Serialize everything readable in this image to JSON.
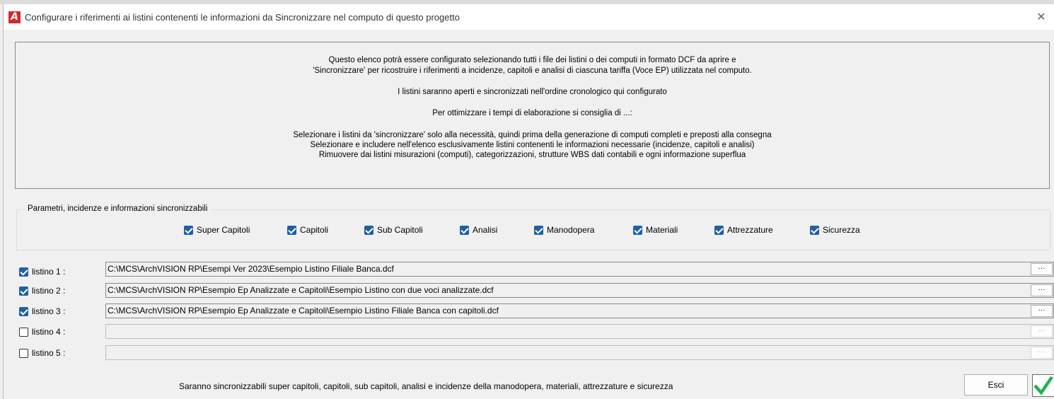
{
  "window": {
    "title": "Configurare i riferimenti ai listini contenenti le informazioni da Sincronizzare nel computo di questo progetto",
    "close_glyph": "✕"
  },
  "info": {
    "lines": [
      "Questo elenco potrà essere configurato selezionando tutti i file dei listini o dei computi in formato DCF da aprire e",
      "'Sincronizzare' per ricostruire i riferimenti a incidenze, capitoli e analisi di ciascuna tariffa (Voce EP) utilizzata nel computo.",
      "I listini saranno aperti e sincronizzati nell'ordine cronologico qui configurato",
      "Per ottimizzare i tempi di elaborazione si consiglia di ...:",
      "Selezionare i listini da 'sincronizzare' solo alla necessità, quindi prima della generazione di computi completi e preposti alla consegna",
      "Selezionare e includere nell'elenco esclusivamente listini contenenti le informazioni necessarie (incidenze, capitoli e analisi)",
      "Rimuovere dai listini misurazioni (computi), categorizzazioni, strutture WBS dati contabili e ogni informazione superflua"
    ]
  },
  "params": {
    "legend": "Parametri, incidenze e informazioni sincronizzabili",
    "options": [
      {
        "label": "Super Capitoli",
        "checked": true
      },
      {
        "label": "Capitoli",
        "checked": true
      },
      {
        "label": "Sub Capitoli",
        "checked": true
      },
      {
        "label": "Analisi",
        "checked": true
      },
      {
        "label": "Manodopera",
        "checked": true
      },
      {
        "label": "Materiali",
        "checked": true
      },
      {
        "label": "Attrezzature",
        "checked": true
      },
      {
        "label": "Sicurezza",
        "checked": true
      }
    ]
  },
  "listini": [
    {
      "label": "listino 1 :",
      "checked": true,
      "path": "C:\\MCS\\ArchVISION RP\\Esempi Ver 2023\\Esempio Listino Filiale Banca.dcf",
      "browse": "···"
    },
    {
      "label": "listino 2 :",
      "checked": true,
      "path": "C:\\MCS\\ArchVISION RP\\Esempio Ep Analizzate e Capitoli\\Esempio Listino con due voci analizzate.dcf",
      "browse": "···"
    },
    {
      "label": "listino 3 :",
      "checked": true,
      "path": "C:\\MCS\\ArchVISION RP\\Esempio Ep Analizzate e Capitoli\\Esempio Listino Filiale Banca con capitoli.dcf",
      "browse": "···"
    },
    {
      "label": "listino 4 :",
      "checked": false,
      "path": "",
      "browse": "···"
    },
    {
      "label": "listino 5 :",
      "checked": false,
      "path": "",
      "browse": "···"
    }
  ],
  "footer": {
    "note": "Saranno sincronizzabili super capitoli, capitoli, sub capitoli, analisi e incidenze della manodopera, materiali, attrezzature e sicurezza",
    "esci_label": "Esci"
  },
  "colors": {
    "accent": "#1f5fa8",
    "app_icon": "#d8262a",
    "ok_check": "#22b14c"
  },
  "icons": {
    "app": "archvision-logo-icon",
    "ok": "green-check-icon"
  }
}
